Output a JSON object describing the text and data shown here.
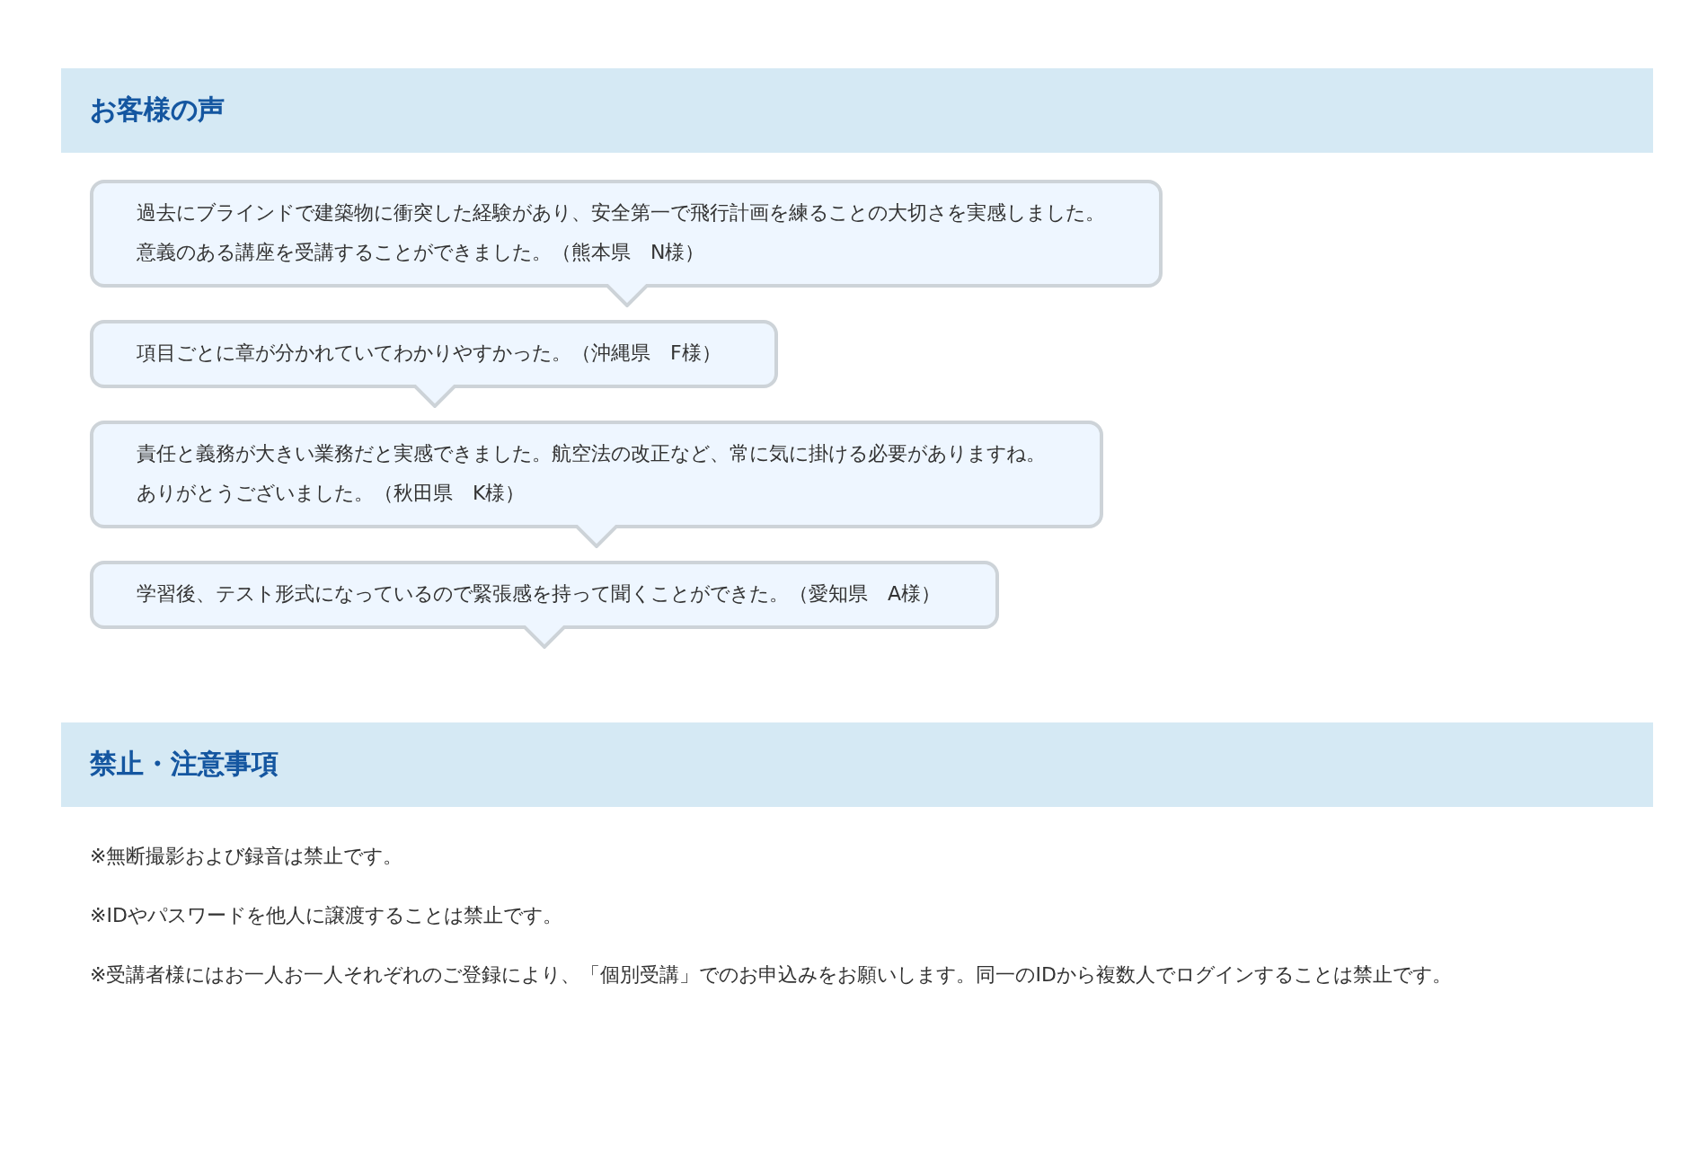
{
  "sections": [
    {
      "title": "お客様の声",
      "kind": "bubbles",
      "items": [
        [
          "過去にブラインドで建築物に衝突した経験があり、安全第一で飛行計画を練ることの大切さを実感しました。",
          "意義のある講座を受講することができました。（熊本県　N様）"
        ],
        [
          "項目ごとに章が分かれていてわかりやすかった。（沖縄県　F様）"
        ],
        [
          "責任と義務が大きい業務だと実感できました。航空法の改正など、常に気に掛ける必要がありますね。",
          "ありがとうございました。（秋田県　K様）"
        ],
        [
          "学習後、テスト形式になっているので緊張感を持って聞くことができた。（愛知県　A様）"
        ]
      ]
    },
    {
      "title": "禁止・注意事項",
      "kind": "notes",
      "items": [
        "※無断撮影および録音は禁止です。",
        "※IDやパスワードを他人に譲渡することは禁止です。",
        "※受講者様にはお一人お一人それぞれのご登録により、「個別受講」でのお申込みをお願いします。同一のIDから複数人でログインすることは禁止です。"
      ]
    }
  ]
}
